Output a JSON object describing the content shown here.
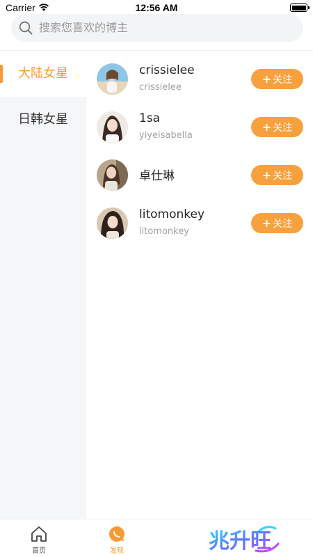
{
  "status_bar": {
    "carrier": "Carrier",
    "time": "12:56 AM"
  },
  "search": {
    "placeholder": "搜索您喜欢的博主",
    "icon": "search-icon"
  },
  "categories": [
    {
      "label": "大陆女星",
      "active": true
    },
    {
      "label": "日韩女星",
      "active": false
    }
  ],
  "bloggers": [
    {
      "name": "crissielee",
      "handle": "crissielee",
      "follow_label": "关注"
    },
    {
      "name": "1sa",
      "handle": "yiyeisabella",
      "follow_label": "关注"
    },
    {
      "name": "卓仕琳",
      "handle": "",
      "follow_label": "关注"
    },
    {
      "name": "litomonkey",
      "handle": "litomonkey",
      "follow_label": "关注"
    }
  ],
  "tabs": [
    {
      "label": "首页",
      "icon": "home-icon",
      "active": false
    },
    {
      "label": "发现",
      "icon": "discover-icon",
      "active": true
    }
  ],
  "brand": {
    "logo_text": "兆升旺"
  },
  "colors": {
    "accent": "#f59a35",
    "follow_button": "#f7a13e",
    "sidebar_bg": "#f5f6f8",
    "search_bg": "#f3f4f6"
  }
}
